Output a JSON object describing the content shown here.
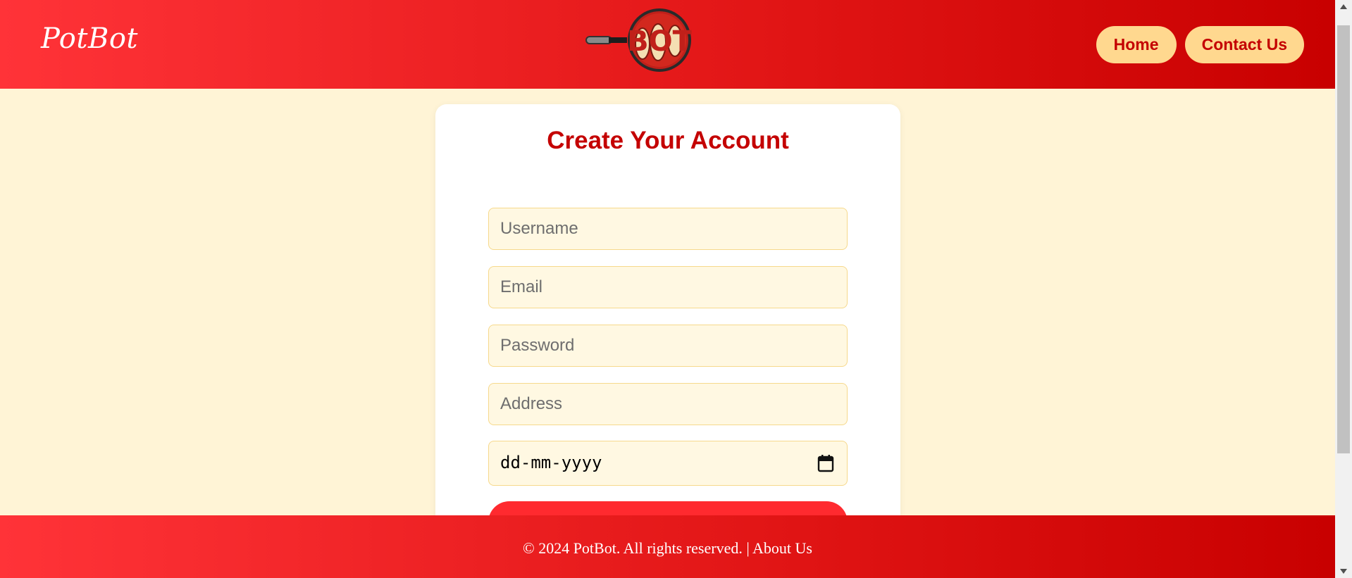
{
  "header": {
    "brand": "PotBot",
    "logo_text": "BOT",
    "nav": [
      {
        "label": "Home"
      },
      {
        "label": "Contact Us"
      }
    ]
  },
  "form": {
    "title": "Create Your Account",
    "fields": {
      "username_placeholder": "Username",
      "email_placeholder": "Email",
      "password_placeholder": "Password",
      "address_placeholder": "Address",
      "date_placeholder": "dd-mm-yyyy"
    }
  },
  "footer": {
    "copyright": "© 2024 PotBot. All rights reserved. | ",
    "about_label": "About Us"
  },
  "colors": {
    "header_gradient_start": "#ff3338",
    "header_gradient_end": "#c80000",
    "page_background": "#fff4d6",
    "accent": "#c40000",
    "nav_button_bg": "#ffd88f",
    "input_bg": "#fff8e2"
  }
}
